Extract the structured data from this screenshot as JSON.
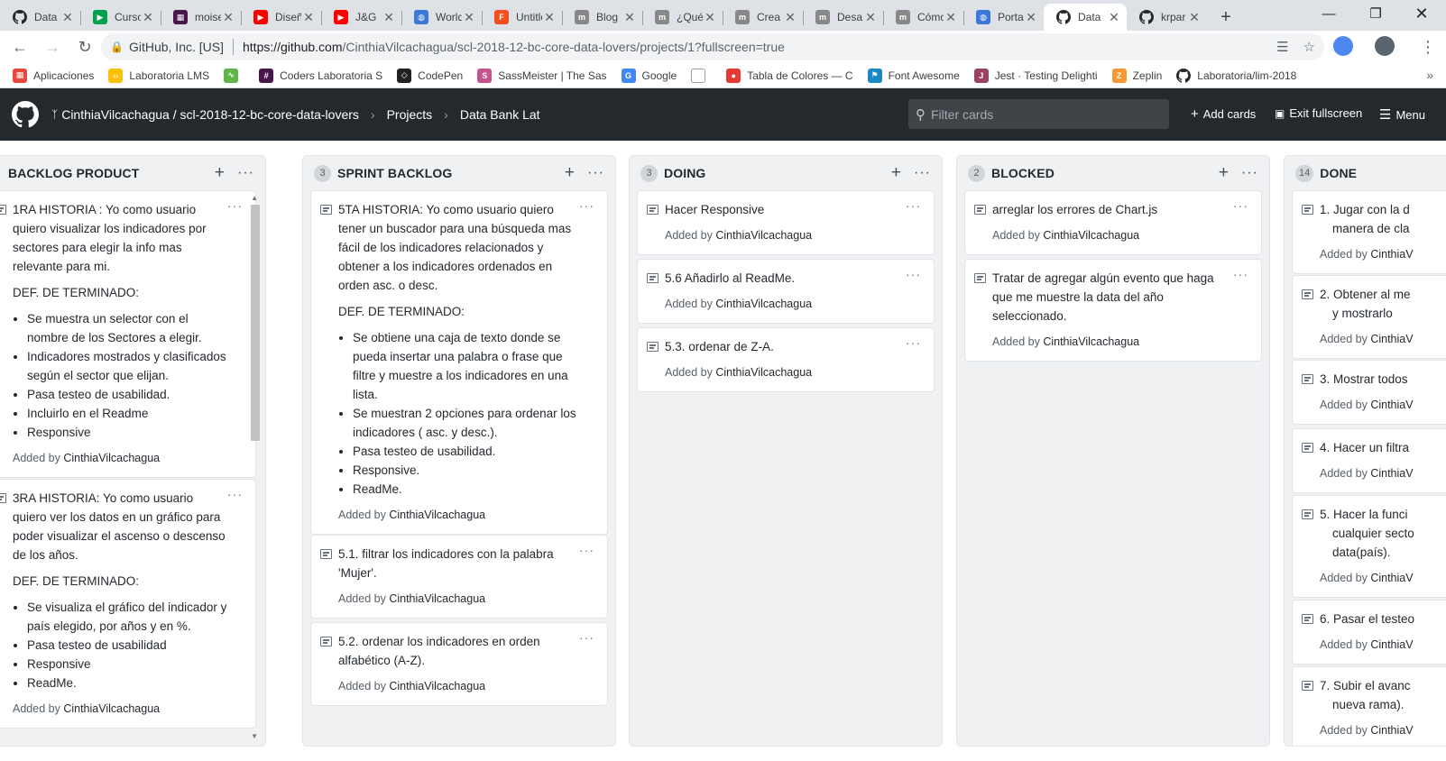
{
  "browser": {
    "tabs": [
      {
        "title": "Data",
        "icon": "github-icon",
        "color": "#24292e",
        "glyph": ""
      },
      {
        "title": "Curso",
        "icon": "play-arrow-icon",
        "color": "#00a14b",
        "glyph": "▶"
      },
      {
        "title": "moise",
        "icon": "grid-icon",
        "color": "#4a154b",
        "glyph": "▦"
      },
      {
        "title": "Diseño",
        "icon": "youtube-icon",
        "color": "#ff0000",
        "glyph": "▶"
      },
      {
        "title": "J&G",
        "icon": "youtube-icon",
        "color": "#ff0000",
        "glyph": "▶"
      },
      {
        "title": "World",
        "icon": "globe-icon",
        "color": "#3c78d8",
        "glyph": "◍"
      },
      {
        "title": "Untitled",
        "icon": "figma-icon",
        "color": "#f24e1e",
        "glyph": "F"
      },
      {
        "title": "Blog",
        "icon": "medium-icon",
        "color": "#888888",
        "glyph": "m"
      },
      {
        "title": "¿Qué",
        "icon": "medium-icon",
        "color": "#888888",
        "glyph": "m"
      },
      {
        "title": "Crea",
        "icon": "medium-icon",
        "color": "#888888",
        "glyph": "m"
      },
      {
        "title": "Desa",
        "icon": "medium-icon",
        "color": "#888888",
        "glyph": "m"
      },
      {
        "title": "Cómo",
        "icon": "medium-icon",
        "color": "#888888",
        "glyph": "m"
      },
      {
        "title": "Porta",
        "icon": "globe-icon",
        "color": "#3c78d8",
        "glyph": "◍"
      },
      {
        "title": "Data",
        "icon": "github-icon",
        "color": "#24292e",
        "glyph": "",
        "active": true
      },
      {
        "title": "krpar",
        "icon": "github-icon",
        "color": "#24292e",
        "glyph": ""
      }
    ],
    "address": {
      "site": "GitHub, Inc. [US]",
      "url_prefix": "https://github.com",
      "url_path": "/CinthiaVilcachagua/scl-2018-12-bc-core-data-lovers/projects/1?fullscreen=true"
    },
    "bookmarks": [
      {
        "label": "Aplicaciones",
        "icon": "apps-grid-icon",
        "color": "#e8453c"
      },
      {
        "label": "Laboratoria LMS",
        "icon": "laboratoria-icon",
        "color": "#ffc107"
      },
      {
        "label": "",
        "icon": "chart-icon",
        "color": "#5fb548"
      },
      {
        "label": "Coders Laboratoria S",
        "icon": "slack-icon",
        "color": "#4a154b"
      },
      {
        "label": "CodePen",
        "icon": "codepen-icon",
        "color": "#222222"
      },
      {
        "label": "SassMeister | The Sas",
        "icon": "sassmeister-icon",
        "color": "#c6538c"
      },
      {
        "label": "Google",
        "icon": "google-icon",
        "color": "#4285f4"
      },
      {
        "label": "",
        "icon": "page-icon",
        "color": "#9aa0a6"
      },
      {
        "label": "Tabla de Colores — C",
        "icon": "color-wheel-icon",
        "color": "#e53935"
      },
      {
        "label": "Font Awesome",
        "icon": "flag-icon",
        "color": "#1c88c7"
      },
      {
        "label": "Jest · Testing Delighti",
        "icon": "jest-icon",
        "color": "#99425b"
      },
      {
        "label": "Zeplin",
        "icon": "zeplin-icon",
        "color": "#f69833"
      },
      {
        "label": "Laboratoria/lim-2018",
        "icon": "github-icon",
        "color": "#24292e"
      }
    ]
  },
  "header": {
    "owner": "CinthiaVilcachagua",
    "repo": "scl-2018-12-bc-core-data-lovers",
    "repo_sep": " / ",
    "projects": "Projects",
    "project": "Data Bank Lat",
    "filter_placeholder": "Filter cards",
    "add_cards": "Add cards",
    "exit_fullscreen": "Exit fullscreen",
    "menu": "Menu"
  },
  "columns": [
    {
      "title": "BACKLOG PRODUCT",
      "count": "",
      "cards": [
        {
          "title": "1RA HISTORIA : Yo como usuario quiero visualizar los indicadores por sectores para elegir la info mas relevante para mi.",
          "subtitle": "DEF. DE TERMINADO:",
          "items": [
            "Se muestra un selector con el nombre de los Sectores a elegir.",
            "Indicadores mostrados y clasificados según el sector que elijan.",
            "Pasa testeo de usabilidad.",
            "Incluirlo en el Readme",
            "Responsive"
          ],
          "added_by": "CinthiaVilcachagua"
        },
        {
          "title": "3RA HISTORIA: Yo como usuario quiero ver los datos en un gráfico para poder visualizar el ascenso o descenso de los años.",
          "subtitle": "DEF. DE TERMINADO:",
          "items": [
            "Se visualiza el gráfico del indicador y país elegido, por años y en %.",
            "Pasa testeo de usabilidad",
            "Responsive",
            "ReadMe."
          ],
          "added_by": "CinthiaVilcachagua"
        }
      ]
    },
    {
      "title": "SPRINT BACKLOG",
      "count": "3",
      "cards": [
        {
          "title": "5TA HISTORIA: Yo como usuario quiero tener un buscador para una búsqueda mas fácil de los indicadores relacionados y obtener a los indicadores ordenados en orden asc. o desc.",
          "subtitle": "DEF. DE TERMINADO:",
          "items": [
            "Se obtiene una caja de texto donde se pueda insertar una palabra o frase que filtre y muestre a los indicadores en una lista.",
            "Se muestran 2 opciones para ordenar los indicadores ( asc. y desc.).",
            "Pasa testeo de usabilidad.",
            "Responsive.",
            "ReadMe."
          ],
          "added_by": "CinthiaVilcachagua"
        },
        {
          "title": "5.1. filtrar los indicadores con la palabra 'Mujer'.",
          "added_by": "CinthiaVilcachagua"
        },
        {
          "title": "5.2. ordenar los indicadores en orden alfabético (A-Z).",
          "added_by": "CinthiaVilcachagua"
        }
      ]
    },
    {
      "title": "DOING",
      "count": "3",
      "cards": [
        {
          "title": "Hacer Responsive",
          "added_by": "CinthiaVilcachagua"
        },
        {
          "title": "5.6 Añadirlo al ReadMe.",
          "added_by": "CinthiaVilcachagua"
        },
        {
          "title": "5.3. ordenar de Z-A.",
          "added_by": "CinthiaVilcachagua"
        }
      ]
    },
    {
      "title": "BLOCKED",
      "count": "2",
      "cards": [
        {
          "title": "arreglar los errores de Chart.js",
          "added_by": "CinthiaVilcachagua"
        },
        {
          "title": "Tratar de agregar algún evento que haga que me muestre la data del año seleccionado.",
          "added_by": "CinthiaVilcachagua"
        }
      ]
    },
    {
      "title": "DONE",
      "count": "14",
      "cards": [
        {
          "title": "1. Jugar con la d",
          "title2": "manera de cla",
          "added_by": "CinthiaV"
        },
        {
          "title": "2. Obtener al me",
          "title2": "y mostrarlo",
          "added_by": "CinthiaV"
        },
        {
          "title": "3. Mostrar todos",
          "added_by": "CinthiaV"
        },
        {
          "title": "4. Hacer un filtra",
          "added_by": "CinthiaV"
        },
        {
          "title": "5. Hacer la funci",
          "title2": "cualquier secto",
          "title3": "data(país).",
          "added_by": "CinthiaV"
        },
        {
          "title": "6. Pasar el testeo",
          "added_by": "CinthiaV"
        },
        {
          "title": "7. Subir el avanc",
          "title2": "nueva rama).",
          "added_by": "CinthiaV"
        }
      ]
    }
  ],
  "added_prefix": "Added by"
}
